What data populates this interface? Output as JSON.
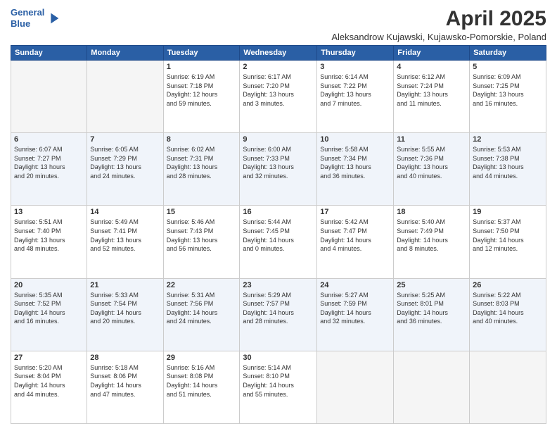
{
  "header": {
    "logo_line1": "General",
    "logo_line2": "Blue",
    "main_title": "April 2025",
    "subtitle": "Aleksandrow Kujawski, Kujawsko-Pomorskie, Poland"
  },
  "days_of_week": [
    "Sunday",
    "Monday",
    "Tuesday",
    "Wednesday",
    "Thursday",
    "Friday",
    "Saturday"
  ],
  "weeks": [
    [
      {
        "day": "",
        "info": ""
      },
      {
        "day": "",
        "info": ""
      },
      {
        "day": "1",
        "info": "Sunrise: 6:19 AM\nSunset: 7:18 PM\nDaylight: 12 hours\nand 59 minutes."
      },
      {
        "day": "2",
        "info": "Sunrise: 6:17 AM\nSunset: 7:20 PM\nDaylight: 13 hours\nand 3 minutes."
      },
      {
        "day": "3",
        "info": "Sunrise: 6:14 AM\nSunset: 7:22 PM\nDaylight: 13 hours\nand 7 minutes."
      },
      {
        "day": "4",
        "info": "Sunrise: 6:12 AM\nSunset: 7:24 PM\nDaylight: 13 hours\nand 11 minutes."
      },
      {
        "day": "5",
        "info": "Sunrise: 6:09 AM\nSunset: 7:25 PM\nDaylight: 13 hours\nand 16 minutes."
      }
    ],
    [
      {
        "day": "6",
        "info": "Sunrise: 6:07 AM\nSunset: 7:27 PM\nDaylight: 13 hours\nand 20 minutes."
      },
      {
        "day": "7",
        "info": "Sunrise: 6:05 AM\nSunset: 7:29 PM\nDaylight: 13 hours\nand 24 minutes."
      },
      {
        "day": "8",
        "info": "Sunrise: 6:02 AM\nSunset: 7:31 PM\nDaylight: 13 hours\nand 28 minutes."
      },
      {
        "day": "9",
        "info": "Sunrise: 6:00 AM\nSunset: 7:33 PM\nDaylight: 13 hours\nand 32 minutes."
      },
      {
        "day": "10",
        "info": "Sunrise: 5:58 AM\nSunset: 7:34 PM\nDaylight: 13 hours\nand 36 minutes."
      },
      {
        "day": "11",
        "info": "Sunrise: 5:55 AM\nSunset: 7:36 PM\nDaylight: 13 hours\nand 40 minutes."
      },
      {
        "day": "12",
        "info": "Sunrise: 5:53 AM\nSunset: 7:38 PM\nDaylight: 13 hours\nand 44 minutes."
      }
    ],
    [
      {
        "day": "13",
        "info": "Sunrise: 5:51 AM\nSunset: 7:40 PM\nDaylight: 13 hours\nand 48 minutes."
      },
      {
        "day": "14",
        "info": "Sunrise: 5:49 AM\nSunset: 7:41 PM\nDaylight: 13 hours\nand 52 minutes."
      },
      {
        "day": "15",
        "info": "Sunrise: 5:46 AM\nSunset: 7:43 PM\nDaylight: 13 hours\nand 56 minutes."
      },
      {
        "day": "16",
        "info": "Sunrise: 5:44 AM\nSunset: 7:45 PM\nDaylight: 14 hours\nand 0 minutes."
      },
      {
        "day": "17",
        "info": "Sunrise: 5:42 AM\nSunset: 7:47 PM\nDaylight: 14 hours\nand 4 minutes."
      },
      {
        "day": "18",
        "info": "Sunrise: 5:40 AM\nSunset: 7:49 PM\nDaylight: 14 hours\nand 8 minutes."
      },
      {
        "day": "19",
        "info": "Sunrise: 5:37 AM\nSunset: 7:50 PM\nDaylight: 14 hours\nand 12 minutes."
      }
    ],
    [
      {
        "day": "20",
        "info": "Sunrise: 5:35 AM\nSunset: 7:52 PM\nDaylight: 14 hours\nand 16 minutes."
      },
      {
        "day": "21",
        "info": "Sunrise: 5:33 AM\nSunset: 7:54 PM\nDaylight: 14 hours\nand 20 minutes."
      },
      {
        "day": "22",
        "info": "Sunrise: 5:31 AM\nSunset: 7:56 PM\nDaylight: 14 hours\nand 24 minutes."
      },
      {
        "day": "23",
        "info": "Sunrise: 5:29 AM\nSunset: 7:57 PM\nDaylight: 14 hours\nand 28 minutes."
      },
      {
        "day": "24",
        "info": "Sunrise: 5:27 AM\nSunset: 7:59 PM\nDaylight: 14 hours\nand 32 minutes."
      },
      {
        "day": "25",
        "info": "Sunrise: 5:25 AM\nSunset: 8:01 PM\nDaylight: 14 hours\nand 36 minutes."
      },
      {
        "day": "26",
        "info": "Sunrise: 5:22 AM\nSunset: 8:03 PM\nDaylight: 14 hours\nand 40 minutes."
      }
    ],
    [
      {
        "day": "27",
        "info": "Sunrise: 5:20 AM\nSunset: 8:04 PM\nDaylight: 14 hours\nand 44 minutes."
      },
      {
        "day": "28",
        "info": "Sunrise: 5:18 AM\nSunset: 8:06 PM\nDaylight: 14 hours\nand 47 minutes."
      },
      {
        "day": "29",
        "info": "Sunrise: 5:16 AM\nSunset: 8:08 PM\nDaylight: 14 hours\nand 51 minutes."
      },
      {
        "day": "30",
        "info": "Sunrise: 5:14 AM\nSunset: 8:10 PM\nDaylight: 14 hours\nand 55 minutes."
      },
      {
        "day": "",
        "info": ""
      },
      {
        "day": "",
        "info": ""
      },
      {
        "day": "",
        "info": ""
      }
    ]
  ]
}
